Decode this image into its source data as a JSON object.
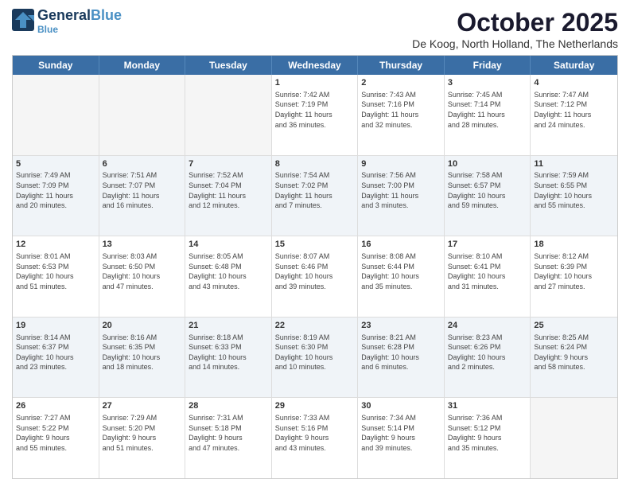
{
  "header": {
    "logo_line1_a": "General",
    "logo_line1_b": "Blue",
    "main_title": "October 2025",
    "sub_title": "De Koog, North Holland, The Netherlands"
  },
  "days": [
    "Sunday",
    "Monday",
    "Tuesday",
    "Wednesday",
    "Thursday",
    "Friday",
    "Saturday"
  ],
  "rows": [
    [
      {
        "day": "",
        "content": ""
      },
      {
        "day": "",
        "content": ""
      },
      {
        "day": "",
        "content": ""
      },
      {
        "day": "1",
        "content": "Sunrise: 7:42 AM\nSunset: 7:19 PM\nDaylight: 11 hours\nand 36 minutes."
      },
      {
        "day": "2",
        "content": "Sunrise: 7:43 AM\nSunset: 7:16 PM\nDaylight: 11 hours\nand 32 minutes."
      },
      {
        "day": "3",
        "content": "Sunrise: 7:45 AM\nSunset: 7:14 PM\nDaylight: 11 hours\nand 28 minutes."
      },
      {
        "day": "4",
        "content": "Sunrise: 7:47 AM\nSunset: 7:12 PM\nDaylight: 11 hours\nand 24 minutes."
      }
    ],
    [
      {
        "day": "5",
        "content": "Sunrise: 7:49 AM\nSunset: 7:09 PM\nDaylight: 11 hours\nand 20 minutes."
      },
      {
        "day": "6",
        "content": "Sunrise: 7:51 AM\nSunset: 7:07 PM\nDaylight: 11 hours\nand 16 minutes."
      },
      {
        "day": "7",
        "content": "Sunrise: 7:52 AM\nSunset: 7:04 PM\nDaylight: 11 hours\nand 12 minutes."
      },
      {
        "day": "8",
        "content": "Sunrise: 7:54 AM\nSunset: 7:02 PM\nDaylight: 11 hours\nand 7 minutes."
      },
      {
        "day": "9",
        "content": "Sunrise: 7:56 AM\nSunset: 7:00 PM\nDaylight: 11 hours\nand 3 minutes."
      },
      {
        "day": "10",
        "content": "Sunrise: 7:58 AM\nSunset: 6:57 PM\nDaylight: 10 hours\nand 59 minutes."
      },
      {
        "day": "11",
        "content": "Sunrise: 7:59 AM\nSunset: 6:55 PM\nDaylight: 10 hours\nand 55 minutes."
      }
    ],
    [
      {
        "day": "12",
        "content": "Sunrise: 8:01 AM\nSunset: 6:53 PM\nDaylight: 10 hours\nand 51 minutes."
      },
      {
        "day": "13",
        "content": "Sunrise: 8:03 AM\nSunset: 6:50 PM\nDaylight: 10 hours\nand 47 minutes."
      },
      {
        "day": "14",
        "content": "Sunrise: 8:05 AM\nSunset: 6:48 PM\nDaylight: 10 hours\nand 43 minutes."
      },
      {
        "day": "15",
        "content": "Sunrise: 8:07 AM\nSunset: 6:46 PM\nDaylight: 10 hours\nand 39 minutes."
      },
      {
        "day": "16",
        "content": "Sunrise: 8:08 AM\nSunset: 6:44 PM\nDaylight: 10 hours\nand 35 minutes."
      },
      {
        "day": "17",
        "content": "Sunrise: 8:10 AM\nSunset: 6:41 PM\nDaylight: 10 hours\nand 31 minutes."
      },
      {
        "day": "18",
        "content": "Sunrise: 8:12 AM\nSunset: 6:39 PM\nDaylight: 10 hours\nand 27 minutes."
      }
    ],
    [
      {
        "day": "19",
        "content": "Sunrise: 8:14 AM\nSunset: 6:37 PM\nDaylight: 10 hours\nand 23 minutes."
      },
      {
        "day": "20",
        "content": "Sunrise: 8:16 AM\nSunset: 6:35 PM\nDaylight: 10 hours\nand 18 minutes."
      },
      {
        "day": "21",
        "content": "Sunrise: 8:18 AM\nSunset: 6:33 PM\nDaylight: 10 hours\nand 14 minutes."
      },
      {
        "day": "22",
        "content": "Sunrise: 8:19 AM\nSunset: 6:30 PM\nDaylight: 10 hours\nand 10 minutes."
      },
      {
        "day": "23",
        "content": "Sunrise: 8:21 AM\nSunset: 6:28 PM\nDaylight: 10 hours\nand 6 minutes."
      },
      {
        "day": "24",
        "content": "Sunrise: 8:23 AM\nSunset: 6:26 PM\nDaylight: 10 hours\nand 2 minutes."
      },
      {
        "day": "25",
        "content": "Sunrise: 8:25 AM\nSunset: 6:24 PM\nDaylight: 9 hours\nand 58 minutes."
      }
    ],
    [
      {
        "day": "26",
        "content": "Sunrise: 7:27 AM\nSunset: 5:22 PM\nDaylight: 9 hours\nand 55 minutes."
      },
      {
        "day": "27",
        "content": "Sunrise: 7:29 AM\nSunset: 5:20 PM\nDaylight: 9 hours\nand 51 minutes."
      },
      {
        "day": "28",
        "content": "Sunrise: 7:31 AM\nSunset: 5:18 PM\nDaylight: 9 hours\nand 47 minutes."
      },
      {
        "day": "29",
        "content": "Sunrise: 7:33 AM\nSunset: 5:16 PM\nDaylight: 9 hours\nand 43 minutes."
      },
      {
        "day": "30",
        "content": "Sunrise: 7:34 AM\nSunset: 5:14 PM\nDaylight: 9 hours\nand 39 minutes."
      },
      {
        "day": "31",
        "content": "Sunrise: 7:36 AM\nSunset: 5:12 PM\nDaylight: 9 hours\nand 35 minutes."
      },
      {
        "day": "",
        "content": ""
      }
    ]
  ]
}
